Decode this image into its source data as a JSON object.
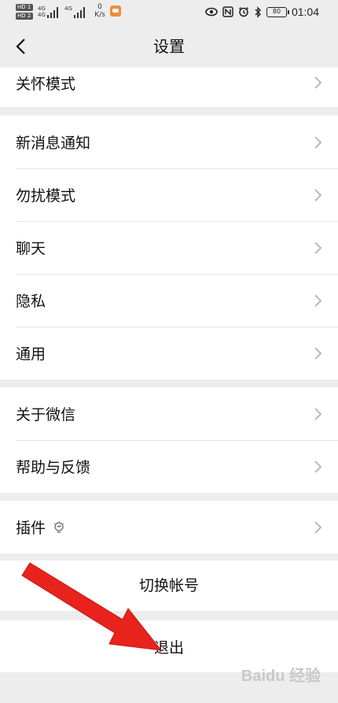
{
  "status_bar": {
    "net_top": "4G",
    "net_bottom": "4G",
    "speed_value": "0",
    "speed_unit": "K/s",
    "time": "01:04",
    "battery": "80",
    "icons": [
      "eye-icon",
      "nfc-icon",
      "alarm-icon",
      "bluetooth-icon",
      "battery-icon"
    ]
  },
  "nav": {
    "title": "设置",
    "back_icon": "chevron-left-icon"
  },
  "groups": [
    {
      "items": [
        {
          "label": "关怀模式"
        }
      ]
    },
    {
      "items": [
        {
          "label": "新消息通知"
        },
        {
          "label": "勿扰模式"
        },
        {
          "label": "聊天"
        },
        {
          "label": "隐私"
        },
        {
          "label": "通用"
        }
      ]
    },
    {
      "items": [
        {
          "label": "关于微信"
        },
        {
          "label": "帮助与反馈"
        }
      ]
    },
    {
      "items": [
        {
          "label": "插件",
          "badge_icon": "lightbulb-icon"
        }
      ]
    }
  ],
  "actions": {
    "switch_account": "切换帐号",
    "logout": "退出"
  },
  "annotation": {
    "color": "#e8221c",
    "icon": "arrow-pointer-icon"
  },
  "colors": {
    "background": "#ededed",
    "card": "#ffffff",
    "divider": "#e6e6e6",
    "chevron": "#b2b2b2"
  }
}
